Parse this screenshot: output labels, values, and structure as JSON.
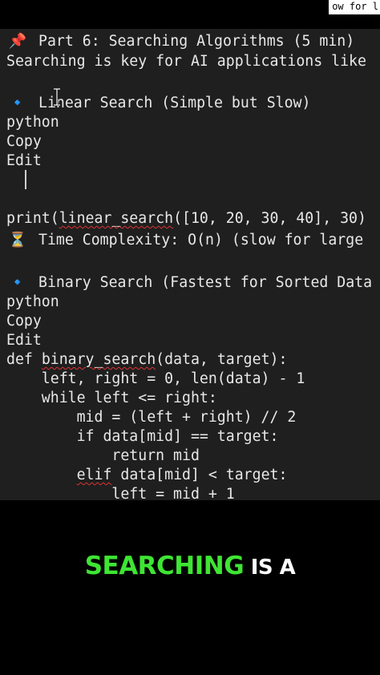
{
  "top_bar": {
    "tab_text": "ow for l"
  },
  "editor": {
    "lines": [
      {
        "icon": "📌",
        "text": "Part 6: Searching Algorithms (5 min)"
      },
      {
        "text": "Searching is key for AI applications like"
      },
      {
        "icon": "🔹",
        "text": "Linear Search (Simple but Slow)"
      },
      {
        "text": "python"
      },
      {
        "text": "Copy"
      },
      {
        "text": "Edit"
      },
      {
        "pre": "print(",
        "squiggle": "linear_search",
        "post": "([10, 20, 30, 40], 30)"
      },
      {
        "icon": "⏳",
        "text": "Time Complexity: O(n) (slow for large"
      },
      {
        "icon": "🔹",
        "text": "Binary Search (Fastest for Sorted Data"
      },
      {
        "text": "python"
      },
      {
        "text": "Copy"
      },
      {
        "text": "Edit"
      },
      {
        "pre": "def ",
        "squiggle": "binary_search",
        "post": "(data, target):"
      },
      {
        "text": "    left, right = 0, len(data) - 1"
      },
      {
        "text": "    while left <= right:"
      },
      {
        "text": "        mid = (left + right) // 2"
      },
      {
        "text": "        if data[mid] == target:"
      },
      {
        "text": "            return mid"
      },
      {
        "pre": "        ",
        "squiggle": "elif",
        "post": " data[mid] < target:"
      },
      {
        "text": "            left = mid + 1"
      }
    ]
  },
  "caption": {
    "highlight": "SEARCHING",
    "rest": " IS A"
  },
  "colors": {
    "caption_highlight": "#3ee533",
    "bullet_diamond": "#4a8fe0",
    "editor_bg": "#1f1f1f"
  }
}
